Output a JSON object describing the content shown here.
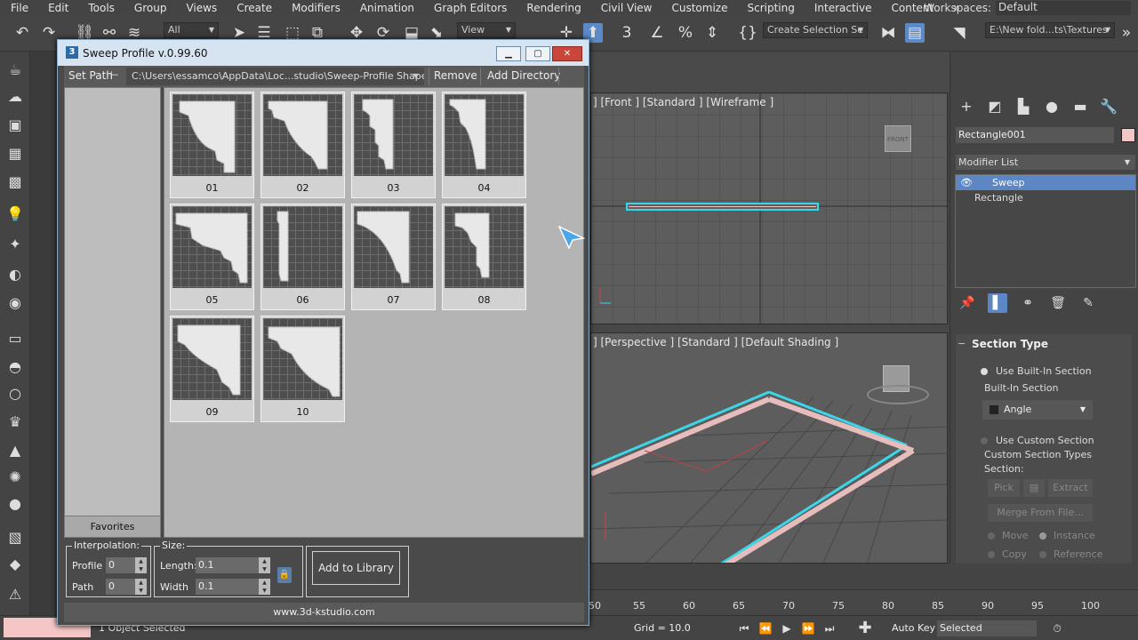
{
  "menu": [
    "File",
    "Edit",
    "Tools",
    "Group",
    "Views",
    "Create",
    "Modifiers",
    "Animation",
    "Graph Editors",
    "Rendering",
    "Civil View",
    "Customize",
    "Scripting",
    "Interactive",
    "Content"
  ],
  "workspace": {
    "label": "Workspaces:",
    "value": "Default"
  },
  "toolbar": {
    "selection_filter": "All",
    "ref_coord": "View",
    "selection_set": "Create Selection Se",
    "project_path": "E:\\New fold...ts\\Textures"
  },
  "dialog": {
    "title": "Sweep Profile v.0.99.60",
    "set_path_label": "Set Path",
    "path": "C:\\Users\\essamco\\AppData\\Loc...studio\\Sweep-Profile Shapes\\",
    "remove_label": "Remove",
    "add_directory_label": "Add Directory",
    "favorites_label": "Favorites",
    "thumbnails": [
      "01",
      "02",
      "03",
      "04",
      "05",
      "06",
      "07",
      "08",
      "09",
      "10"
    ],
    "interpolation": {
      "title": "Interpolation:",
      "profile_label": "Profile",
      "profile_value": "0",
      "path_label": "Path",
      "path_value": "0"
    },
    "size": {
      "title": "Size:",
      "length_label": "Length:",
      "length_value": "0.1",
      "width_label": "Width",
      "width_value": "0.1"
    },
    "add_library_label": "Add to Library",
    "footer": "www.3d-kstudio.com"
  },
  "viewports": {
    "front_label": "[+] [Front ] [Standard ] [Wireframe ]",
    "front_visible": "] [Front ] [Standard ] [Wireframe ]",
    "persp_label": "] [Perspective ] [Standard ] [Default Shading ]"
  },
  "command_panel": {
    "object_name": "Rectangle001",
    "object_color": "#f3c6c6",
    "modifier_list_label": "Modifier List",
    "stack": [
      "Sweep",
      "Rectangle"
    ],
    "section_type_title": "Section Type",
    "use_builtin": "Use Built-In Section",
    "builtin_section_label": "Built-In Section",
    "builtin_value": "Angle",
    "use_custom": "Use Custom Section",
    "custom_types_label": "Custom Section Types",
    "section_label": "Section:",
    "pick_label": "Pick",
    "extract_label": "Extract",
    "merge_label": "Merge From File...",
    "move_label": "Move",
    "instance_label": "Instance",
    "copy_label": "Copy",
    "reference_label": "Reference"
  },
  "timeline": {
    "ticks": [
      "50",
      "55",
      "60",
      "65",
      "70",
      "75",
      "80",
      "85",
      "90",
      "95",
      "100"
    ]
  },
  "status": {
    "selected_text": "1 Object Selected",
    "grid": "Grid = 10.0",
    "auto_key": "Auto Key",
    "key_mode": "Selected"
  },
  "colors": {
    "accent": "#5c86c4",
    "title_bar": "#d6e4f2",
    "close": "#c9463b",
    "sweep_outline": "#3ad7e8"
  }
}
